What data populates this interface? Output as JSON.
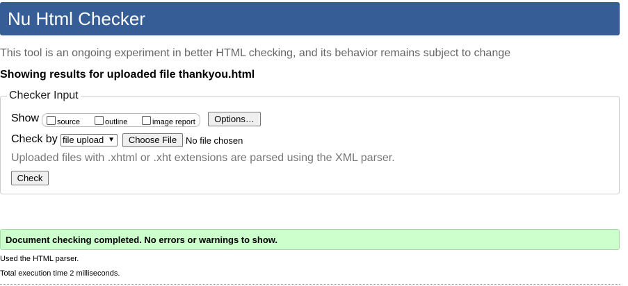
{
  "header": {
    "title": "Nu Html Checker"
  },
  "intro": "This tool is an ongoing experiment in better HTML checking, and its behavior remains subject to change",
  "showing": "Showing results for uploaded file thankyou.html",
  "checker_input": {
    "legend": "Checker Input",
    "show_label": "Show",
    "options": [
      {
        "label": "source",
        "checked": false
      },
      {
        "label": "outline",
        "checked": false
      },
      {
        "label": "image report",
        "checked": false
      }
    ],
    "options_button": "Options…",
    "check_by_label": "Check by",
    "check_by_value": "file upload",
    "choose_file_button": "Choose File",
    "no_file": "No file chosen",
    "note": "Uploaded files with .xhtml or .xht extensions are parsed using the XML parser.",
    "check_button": "Check"
  },
  "result": {
    "message": "Document checking completed. No errors or warnings to show.",
    "color": "#ccffcc"
  },
  "footer": {
    "parser": "Used the HTML parser.",
    "time": "Total execution time 2 milliseconds."
  }
}
